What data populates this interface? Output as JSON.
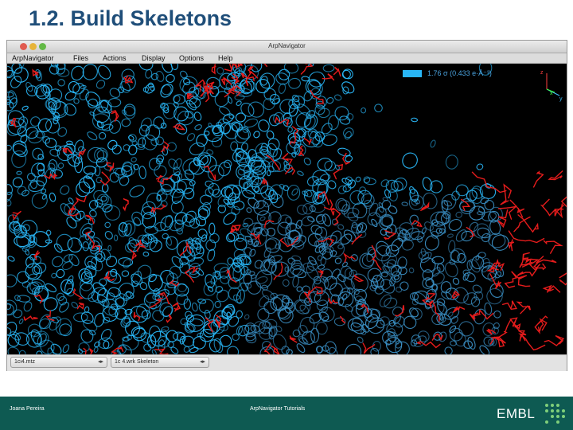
{
  "slide": {
    "title": "1.2. Build Skeletons"
  },
  "window": {
    "title": "ArpNavigator",
    "menu": [
      "ArpNavigator",
      "Files",
      "Actions",
      "Display",
      "Options",
      "Help"
    ],
    "contour_label": "1.76 σ (0.433 e·Å⁻³)",
    "contour_color": "#29b6f6",
    "axes": {
      "x": "x",
      "y": "y",
      "z": "z"
    },
    "status": {
      "left_selector": "1ci4.mtz",
      "right_selector": "1c 4.wrk Skeleton"
    }
  },
  "footer": {
    "author": "Joana Pereira",
    "center": "ArpNavigator Tutorials",
    "logo": "EMBL",
    "background": "#0e5a52"
  },
  "colors": {
    "density_mesh": "#29b6f6",
    "skeleton": "#e51c1c"
  }
}
